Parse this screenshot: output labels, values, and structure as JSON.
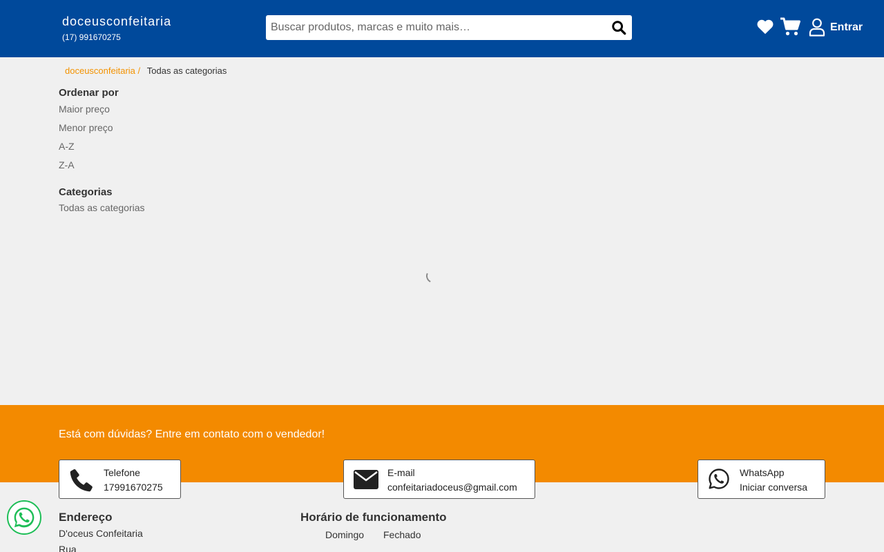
{
  "header": {
    "brand_name": "doceusconfeitaria",
    "brand_phone": "(17) 991670275",
    "search_placeholder": "Buscar produtos, marcas e muito mais…",
    "login_label": "Entrar",
    "colors": {
      "header_bg": "#00499b",
      "accent": "#f38a00"
    }
  },
  "breadcrumb": {
    "home": "doceusconfeitaria /",
    "current": "Todas as categorias"
  },
  "sidebar": {
    "sort_title": "Ordenar por",
    "sort_options": [
      "Maior preço",
      "Menor preço",
      "A-Z",
      "Z-A"
    ],
    "categories_title": "Categorias",
    "categories": [
      "Todas as categorias"
    ]
  },
  "contact": {
    "heading": "Está com dúvidas? Entre em contato com o vendedor!",
    "phone": {
      "title": "Telefone",
      "value": "17991670275",
      "icon": "phone-icon"
    },
    "email": {
      "title": "E-mail",
      "value": "confeitariadoceus@gmail.com",
      "icon": "envelope-icon"
    },
    "whatsapp": {
      "title": "WhatsApp",
      "value": "Iniciar conversa",
      "icon": "whatsapp-icon"
    }
  },
  "footer": {
    "address_title": "Endereço",
    "address_lines": [
      "D'oceus Confeitaria",
      "Rua"
    ],
    "hours_title": "Horário de funcionamento",
    "hours": [
      {
        "day": "Domingo",
        "status": "Fechado"
      }
    ]
  }
}
